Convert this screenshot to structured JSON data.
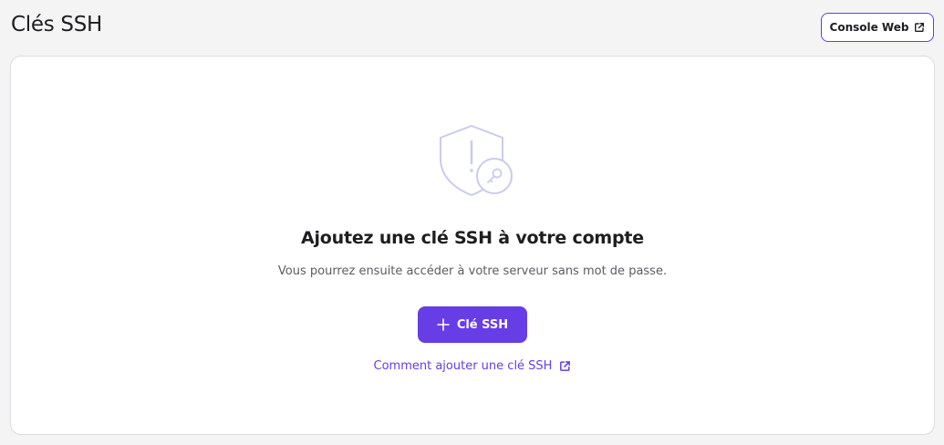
{
  "header": {
    "title": "Clés SSH",
    "console_button_label": "Console Web",
    "console_button_icon": "external-link-icon"
  },
  "empty_state": {
    "illustration_icon": "shield-key-icon",
    "title": "Ajoutez une clé SSH à votre compte",
    "description": "Vous pourrez ensuite accéder à votre serveur sans mot de passe.",
    "add_button_label": "Clé SSH",
    "add_button_icon": "plus-icon",
    "help_link_label": "Comment ajouter une clé SSH",
    "help_link_icon": "external-link-icon"
  },
  "colors": {
    "accent": "#673de6",
    "background": "#f4f4f4",
    "card": "#ffffff",
    "illustration": "#c9cbee"
  }
}
